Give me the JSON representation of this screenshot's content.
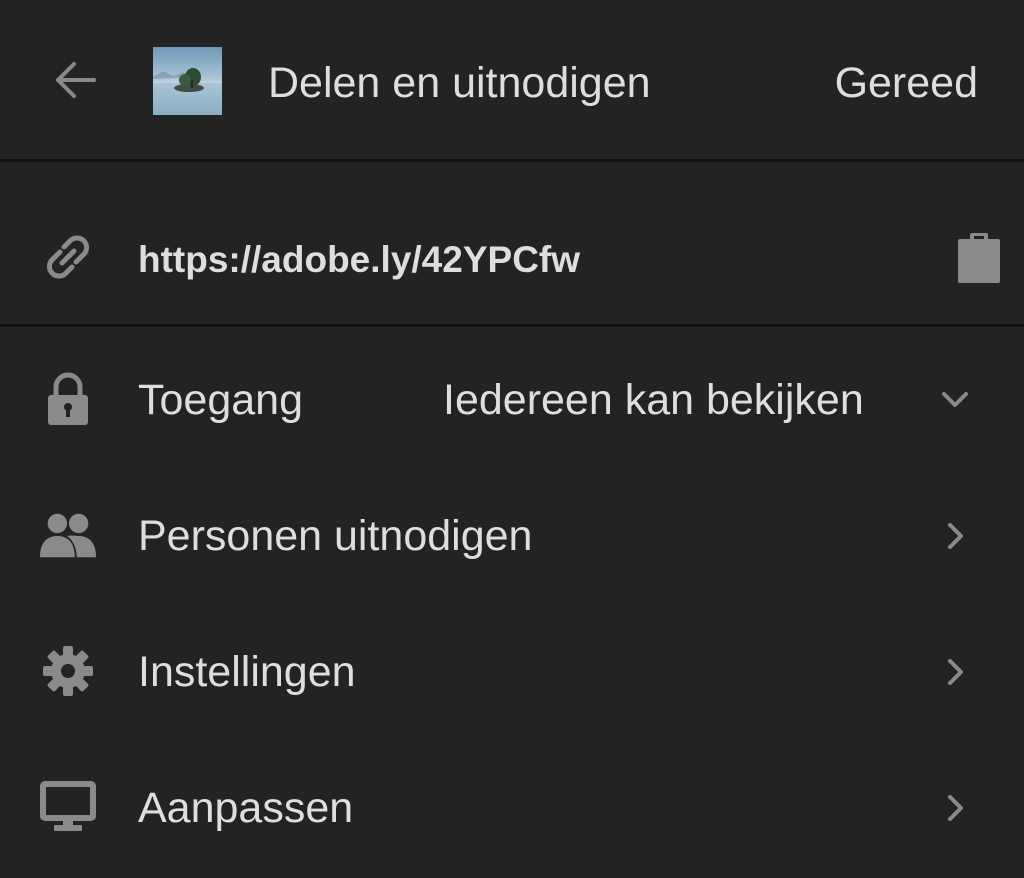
{
  "header": {
    "back_icon": "arrow-left-icon",
    "thumbnail": "photo-thumbnail-lake-island",
    "title": "Delen en uitnodigen",
    "done_label": "Gereed"
  },
  "share_link": {
    "icon": "link-icon",
    "url": "https://adobe.ly/42YPCfw",
    "copy_icon": "clipboard-icon"
  },
  "menu": {
    "items": [
      {
        "id": "access",
        "icon": "lock-icon",
        "label": "Toegang",
        "value": "Iedereen kan bekijken",
        "chevron": "chevron-down-icon"
      },
      {
        "id": "invite",
        "icon": "people-icon",
        "label": "Personen uitnodigen",
        "chevron": "chevron-right-icon"
      },
      {
        "id": "settings",
        "icon": "gear-icon",
        "label": "Instellingen",
        "chevron": "chevron-right-icon"
      },
      {
        "id": "customize",
        "icon": "monitor-icon",
        "label": "Aanpassen",
        "chevron": "chevron-right-icon"
      }
    ]
  },
  "colors": {
    "background": "#232323",
    "divider": "#111111",
    "text": "#dedede",
    "icon": "#8a8a8a"
  }
}
